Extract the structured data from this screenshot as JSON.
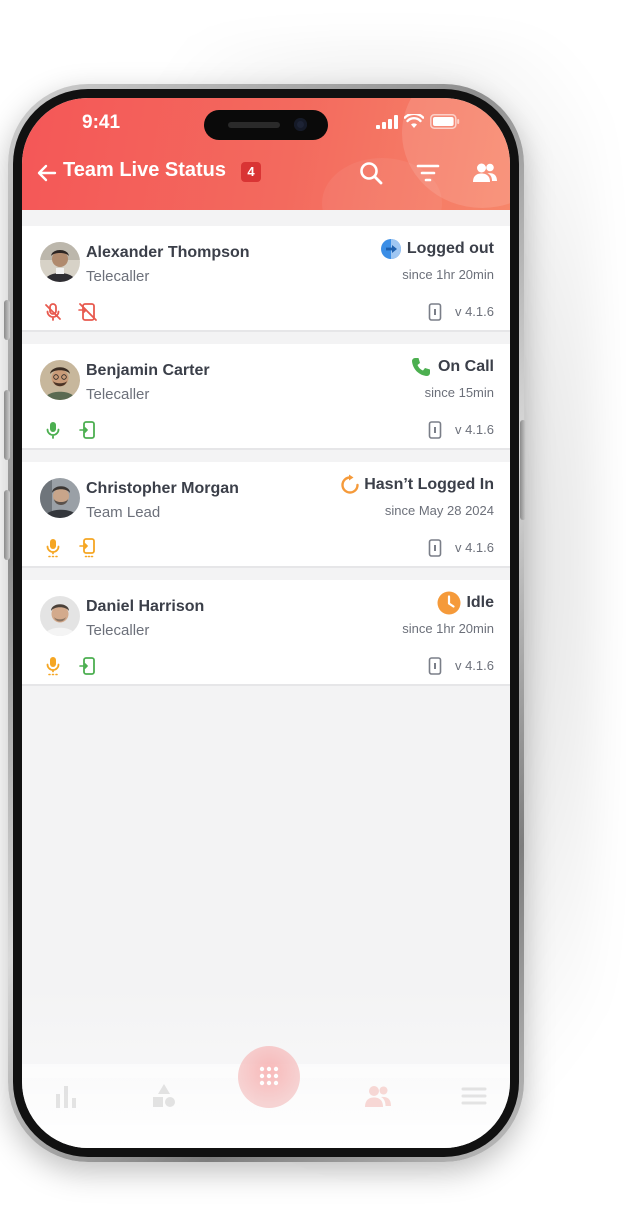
{
  "status_bar": {
    "time": "9:41"
  },
  "appbar": {
    "title": "Team Live Status",
    "count": "4"
  },
  "agents": [
    {
      "name": "Alexander Thompson",
      "role": "Telecaller",
      "status": "Logged out",
      "since": "since 1hr 20min",
      "version": "v 4.1.6",
      "status_color": "#3b8ee6",
      "mic": "off",
      "device": "off"
    },
    {
      "name": "Benjamin Carter",
      "role": "Telecaller",
      "status": "On Call",
      "since": "since 15min",
      "version": "v 4.1.6",
      "status_color": "#4caf50",
      "mic": "on",
      "device": "on"
    },
    {
      "name": "Christopher Morgan",
      "role": "Team Lead",
      "status": "Hasn’t Logged In",
      "since": "since May 28 2024",
      "version": "v 4.1.6",
      "status_color": "#f59a3a",
      "mic": "pending",
      "device": "pending"
    },
    {
      "name": "Daniel Harrison",
      "role": "Telecaller",
      "status": "Idle",
      "since": "since 1hr 20min",
      "version": "v 4.1.6",
      "status_color": "#f59a3a",
      "mic": "pending",
      "device": "on"
    }
  ],
  "colors": {
    "header_start": "#f45757",
    "header_end": "#f7866a",
    "badge": "#d93434",
    "off": "#e85a4f",
    "on": "#4caf50",
    "pending": "#f5a623"
  }
}
